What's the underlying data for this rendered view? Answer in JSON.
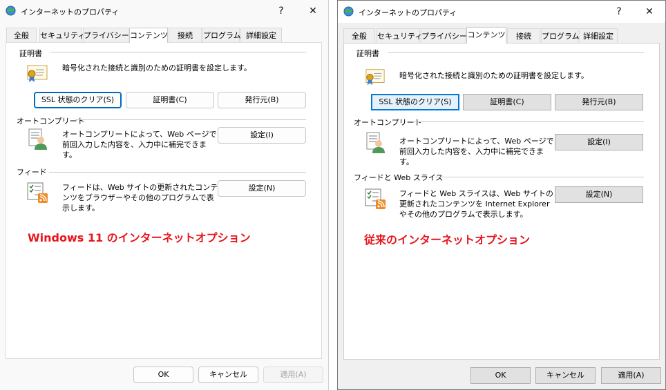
{
  "left": {
    "window_title": "インターネットのプロパティ",
    "help_glyph": "?",
    "close_glyph": "✕",
    "tabs": [
      {
        "label": "全般"
      },
      {
        "label": "セキュリティ"
      },
      {
        "label": "プライバシー"
      },
      {
        "label": "コンテンツ"
      },
      {
        "label": "接続"
      },
      {
        "label": "プログラム"
      },
      {
        "label": "詳細設定"
      }
    ],
    "active_tab": "コンテンツ",
    "cert_group": "証明書",
    "cert_desc": "暗号化された接続と識別のための証明書を設定します。",
    "btn_ssl": "SSL 状態のクリア(S)",
    "btn_cert": "証明書(C)",
    "btn_publisher": "発行元(B)",
    "autocomplete_group": "オートコンプリート",
    "autocomplete_desc": "オートコンプリートによって、Web ページで前回入力した内容を、入力中に補完できます。",
    "btn_autocomplete_settings": "設定(I)",
    "feed_group": "フィード",
    "feed_desc": "フィードは、Web サイトの更新されたコンテンツをブラウザーやその他のプログラムで表示します。",
    "btn_feed_settings": "設定(N)",
    "caption": "Windows 11 のインターネットオプション",
    "btn_ok": "OK",
    "btn_cancel": "キャンセル",
    "btn_apply": "適用(A)",
    "apply_enabled": false
  },
  "right": {
    "window_title": "インターネットのプロパティ",
    "help_glyph": "?",
    "close_glyph": "✕",
    "tabs": [
      {
        "label": "全般"
      },
      {
        "label": "セキュリティ"
      },
      {
        "label": "プライバシー"
      },
      {
        "label": "コンテンツ"
      },
      {
        "label": "接続"
      },
      {
        "label": "プログラム"
      },
      {
        "label": "詳細設定"
      }
    ],
    "active_tab": "コンテンツ",
    "cert_group": "証明書",
    "cert_desc": "暗号化された接続と識別のための証明書を設定します。",
    "btn_ssl": "SSL 状態のクリア(S)",
    "btn_cert": "証明書(C)",
    "btn_publisher": "発行元(B)",
    "autocomplete_group": "オートコンプリート",
    "autocomplete_desc": "オートコンプリートによって、Web ページで前回入力した内容を、入力中に補完できます。",
    "btn_autocomplete_settings": "設定(I)",
    "feed_group": "フィードと Web スライス",
    "feed_desc": "フィードと Web スライスは、Web サイトの更新されたコンテンツを Internet Explorer やその他のプログラムで表示します。",
    "btn_feed_settings": "設定(N)",
    "caption": "従来のインターネットオプション",
    "btn_ok": "OK",
    "btn_cancel": "キャンセル",
    "btn_apply": "適用(A)",
    "apply_enabled": true
  },
  "colors": {
    "caption": "#e8141b",
    "focus_blue": "#0067c0",
    "classic_focus_blue": "#0078d7"
  },
  "icons": [
    "internet-options-icon",
    "certificate-icon",
    "autocomplete-icon",
    "feed-icon"
  ]
}
